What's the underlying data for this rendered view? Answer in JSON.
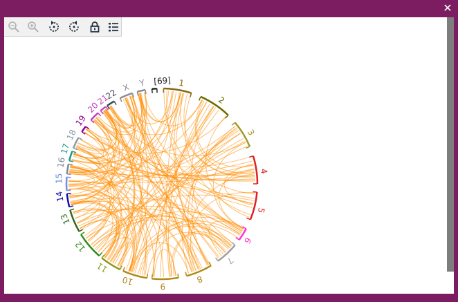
{
  "window": {
    "close_glyph": "✕"
  },
  "toolbar": {
    "buttons": [
      {
        "name": "zoom-out-icon"
      },
      {
        "name": "zoom-in-icon"
      },
      {
        "name": "rotate-left-icon"
      },
      {
        "name": "rotate-right-icon"
      },
      {
        "name": "lock-icon"
      },
      {
        "name": "list-icon"
      }
    ]
  },
  "chart_data": {
    "type": "chord",
    "link_color": "#ff8c00",
    "chromosomes": [
      {
        "label": "1",
        "color": "#8b6914"
      },
      {
        "label": "2",
        "color": "#6b6b00"
      },
      {
        "label": "3",
        "color": "#a09a2a"
      },
      {
        "label": "4",
        "color": "#e02020"
      },
      {
        "label": "5",
        "color": "#e02020"
      },
      {
        "label": "6",
        "color": "#ff33cc"
      },
      {
        "label": "7",
        "color": "#a0a0a0"
      },
      {
        "label": "8",
        "color": "#b08a1a"
      },
      {
        "label": "9",
        "color": "#b08a1a"
      },
      {
        "label": "10",
        "color": "#b08a1a"
      },
      {
        "label": "11",
        "color": "#8a9a1a"
      },
      {
        "label": "12",
        "color": "#2e8b1a"
      },
      {
        "label": "13",
        "color": "#2e6b1a"
      },
      {
        "label": "14",
        "color": "#1010b0"
      },
      {
        "label": "15",
        "color": "#6f8fe0"
      },
      {
        "label": "16",
        "color": "#7a8a9a"
      },
      {
        "label": "17",
        "color": "#1a9a8a"
      },
      {
        "label": "18",
        "color": "#8a9aaa"
      },
      {
        "label": "19",
        "color": "#8b008b"
      },
      {
        "label": "20",
        "color": "#c03ec0"
      },
      {
        "label": "21",
        "color": "#c04ec0"
      },
      {
        "label": "22",
        "color": "#3a4a5a"
      },
      {
        "label": "X",
        "color": "#8a8a9a"
      },
      {
        "label": "Y",
        "color": "#8a8a9a"
      },
      {
        "label": "[69]",
        "color": "#222222"
      }
    ]
  }
}
